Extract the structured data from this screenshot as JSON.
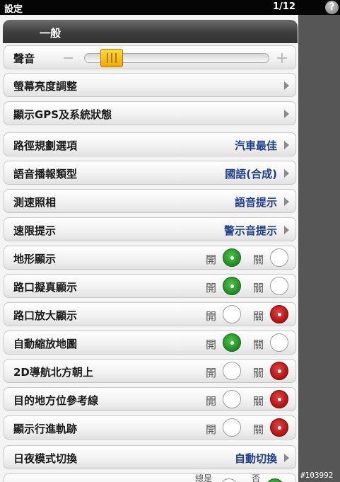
{
  "titlebar": {
    "title": "設定",
    "page": "1/12",
    "help_icon": "?"
  },
  "section": {
    "title": "一般"
  },
  "volume": {
    "label": "聲音",
    "level": 0.13
  },
  "nav_rows": [
    {
      "label": "螢幕亮度調整"
    },
    {
      "label": "顯示GPS及系統狀態"
    }
  ],
  "value_rows": [
    {
      "label": "路徑規劃選項",
      "value": "汽車最佳"
    },
    {
      "label": "語音播報類型",
      "value": "國語(合成)"
    },
    {
      "label": "測速照相",
      "value": "語音提示"
    },
    {
      "label": "速限提示",
      "value": "警示音提示"
    }
  ],
  "on_label": "開",
  "off_label": "關",
  "toggle_rows": [
    {
      "label": "地形顯示",
      "state": "on"
    },
    {
      "label": "路口擬真顯示",
      "state": "on"
    },
    {
      "label": "路口放大顯示",
      "state": "off"
    },
    {
      "label": "自動縮放地圖",
      "state": "on"
    },
    {
      "label": "2D導航北方朝上",
      "state": "off"
    },
    {
      "label": "目的地方位參考線",
      "state": "off"
    },
    {
      "label": "顯示行進軌跡",
      "state": "off"
    }
  ],
  "daynight": {
    "label": "日夜模式切換",
    "value": "自動切換"
  },
  "partial_row": {
    "option_a": "總是",
    "option_b": "否"
  },
  "colors": {
    "on": "#1f8a1f",
    "off": "#b01010",
    "value_text": "#1f3f8a"
  },
  "watermark": "#103992"
}
